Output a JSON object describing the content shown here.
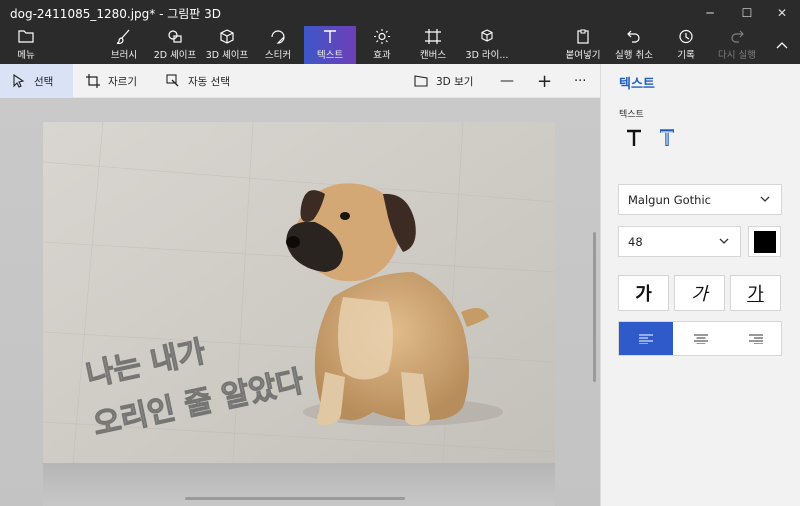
{
  "window": {
    "title": "dog-2411085_1280.jpg* - 그림판 3D",
    "minimize_glyph": "─",
    "maximize_glyph": "☐",
    "close_glyph": "✕"
  },
  "ribbon": {
    "menu": "메뉴",
    "brush": "브러시",
    "shapes2d": "2D 셰이프",
    "shapes3d": "3D 셰이프",
    "sticker": "스티커",
    "text": "텍스트",
    "effects": "효과",
    "canvas": "캔버스",
    "library3d": "3D 라이...",
    "paste": "붙여넣기",
    "undo": "실행 취소",
    "history": "기록",
    "redo": "다시 실행"
  },
  "toolbar": {
    "select": "선택",
    "crop": "자르기",
    "magic_select": "자동 선택",
    "view3d": "3D 보기",
    "zoom_out": "—",
    "zoom_in": "+",
    "more": "···"
  },
  "canvas": {
    "text_line1": "나는 내가",
    "text_line2": "오리인 줄 알았다"
  },
  "panel": {
    "title": "텍스트",
    "section_label": "텍스트",
    "font": "Malgun Gothic",
    "size": "48",
    "color": "#000000",
    "bold_glyph": "가",
    "italic_glyph": "가",
    "underline_glyph": "가",
    "accent_color": "#2e5bc9"
  }
}
